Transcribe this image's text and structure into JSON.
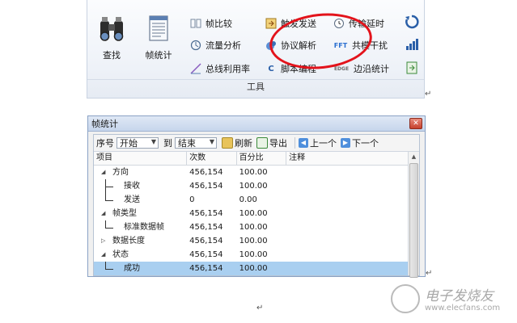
{
  "ribbon": {
    "big_buttons": [
      {
        "label": "查找",
        "icon": "binoculars-icon"
      },
      {
        "label": "帧统计",
        "icon": "document-list-icon"
      }
    ],
    "small_buttons_col1": [
      {
        "label": "帧比较",
        "icon": "compare-icon"
      },
      {
        "label": "流量分析",
        "icon": "traffic-analysis-icon"
      },
      {
        "label": "总线利用率",
        "icon": "bus-utilization-icon"
      }
    ],
    "small_buttons_col2": [
      {
        "label": "触发发送",
        "icon": "trigger-send-icon"
      },
      {
        "label": "协议解析",
        "icon": "protocol-parse-icon"
      },
      {
        "label": "脚本编程",
        "icon": "script-icon"
      }
    ],
    "small_buttons_col3": [
      {
        "label": "传输延时",
        "icon": "clock-icon"
      },
      {
        "label": "共模干扰",
        "icon": "fft-icon",
        "glyph": "FFT"
      },
      {
        "label": "边沿统计",
        "icon": "edge-icon",
        "glyph": "EDGE"
      }
    ],
    "right_icons": [
      "refresh-icon",
      "signal-bars-icon",
      "export-icon"
    ],
    "group_label": "工具",
    "highlight_color": "#e3131b"
  },
  "dialog": {
    "title": "帧统计",
    "close_glyph": "✕",
    "toolbar": {
      "seq_label": "序号",
      "start_value": "开始",
      "to_label": "到",
      "end_value": "结束",
      "refresh_label": "刷新",
      "export_label": "导出",
      "prev_label": "上一个",
      "next_label": "下一个"
    },
    "columns": [
      "项目",
      "次数",
      "百分比",
      "注释"
    ],
    "rows": [
      {
        "item": "方向",
        "count": "456,154",
        "percent": "100.00",
        "note": "",
        "level": 0,
        "expander": "◢"
      },
      {
        "item": "接收",
        "count": "456,154",
        "percent": "100.00",
        "note": "",
        "level": 1
      },
      {
        "item": "发送",
        "count": "0",
        "percent": "0.00",
        "note": "",
        "level": 1
      },
      {
        "item": "帧类型",
        "count": "456,154",
        "percent": "100.00",
        "note": "",
        "level": 0,
        "expander": "◢"
      },
      {
        "item": "标准数据帧",
        "count": "456,154",
        "percent": "100.00",
        "note": "",
        "level": 1
      },
      {
        "item": "数据长度",
        "count": "456,154",
        "percent": "100.00",
        "note": "",
        "level": 0,
        "expander": "▷"
      },
      {
        "item": "状态",
        "count": "456,154",
        "percent": "100.00",
        "note": "",
        "level": 0,
        "expander": "◢"
      },
      {
        "item": "成功",
        "count": "456,154",
        "percent": "100.00",
        "note": "",
        "level": 1,
        "selected": true
      }
    ]
  },
  "watermark": {
    "text_cn": "电子发烧友",
    "text_url": "www.elecfans.com"
  },
  "return_mark": "↵"
}
